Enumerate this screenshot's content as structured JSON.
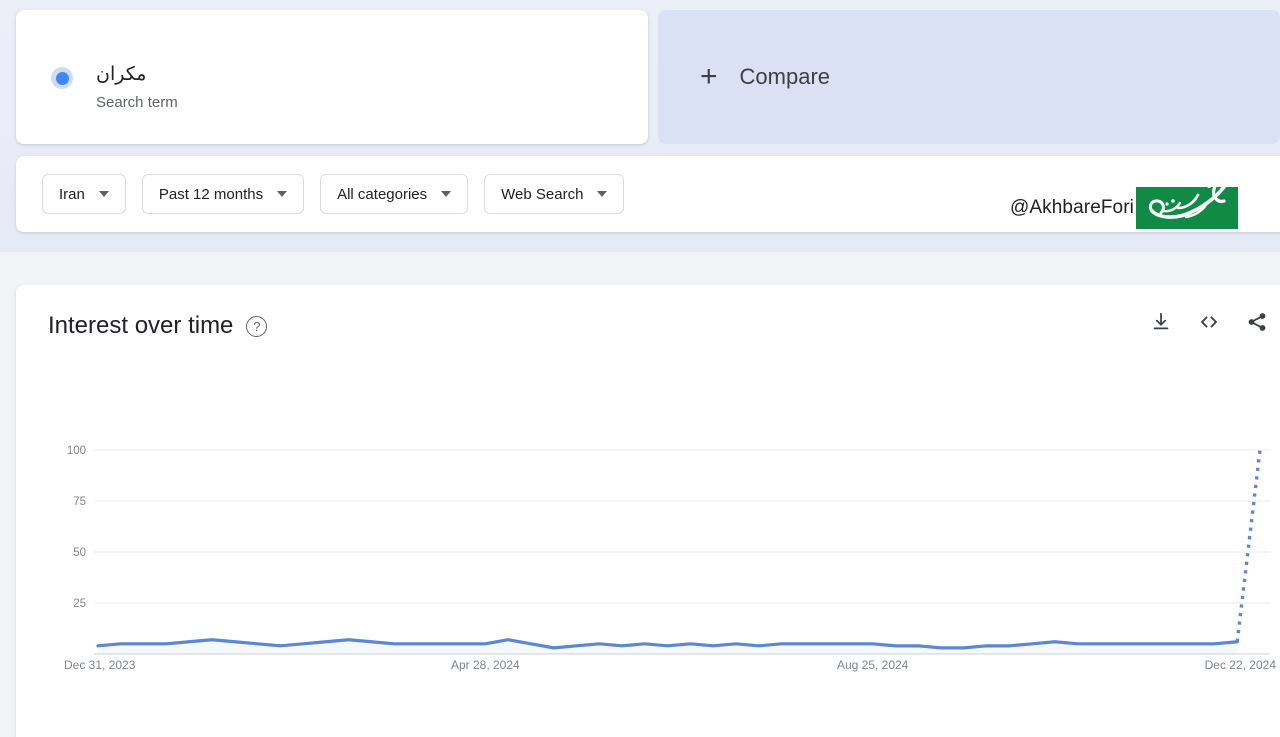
{
  "search_term": {
    "term": "مکران",
    "subtitle": "Search term",
    "dot_color": "#4285f4"
  },
  "compare": {
    "plus_icon": "plus-icon",
    "label": "Compare",
    "background": "#dbe1f5"
  },
  "filters": [
    {
      "name": "location",
      "label": "Iran"
    },
    {
      "name": "time-range",
      "label": "Past 12 months"
    },
    {
      "name": "category",
      "label": "All categories"
    },
    {
      "name": "search-type",
      "label": "Web Search"
    }
  ],
  "watermark": {
    "handle": "@AkhbareFori",
    "logo_text": "خبر فوری",
    "logo_color": "#118a46"
  },
  "chart_panel": {
    "title": "Interest over time",
    "help_icon": "help-circle-icon",
    "actions": [
      {
        "name": "download-icon",
        "label": "Download"
      },
      {
        "name": "embed-code-icon",
        "label": "Embed"
      },
      {
        "name": "share-icon",
        "label": "Share"
      }
    ]
  },
  "chart_data": {
    "type": "line",
    "title": "Interest over time",
    "xlabel": "",
    "ylabel": "",
    "ylim": [
      0,
      100
    ],
    "y_ticks": [
      25,
      50,
      75,
      100
    ],
    "grid": true,
    "legend": false,
    "line_color": "#5b87d4",
    "partial_style": "dotted",
    "x_tick_labels": [
      "Dec 31, 2023",
      "Apr 28, 2024",
      "Aug 25, 2024",
      "Dec 22, 2024"
    ],
    "x_tick_positions": [
      0,
      17,
      34,
      51
    ],
    "x": [
      "Dec 31, 2023",
      "Jan 7, 2024",
      "Jan 14, 2024",
      "Jan 21, 2024",
      "Jan 28, 2024",
      "Feb 4, 2024",
      "Feb 11, 2024",
      "Feb 18, 2024",
      "Feb 25, 2024",
      "Mar 3, 2024",
      "Mar 10, 2024",
      "Mar 17, 2024",
      "Mar 24, 2024",
      "Mar 31, 2024",
      "Apr 7, 2024",
      "Apr 14, 2024",
      "Apr 21, 2024",
      "Apr 28, 2024",
      "May 5, 2024",
      "May 12, 2024",
      "May 19, 2024",
      "May 26, 2024",
      "Jun 2, 2024",
      "Jun 9, 2024",
      "Jun 16, 2024",
      "Jun 23, 2024",
      "Jun 30, 2024",
      "Jul 7, 2024",
      "Jul 14, 2024",
      "Jul 21, 2024",
      "Jul 28, 2024",
      "Aug 4, 2024",
      "Aug 11, 2024",
      "Aug 18, 2024",
      "Aug 25, 2024",
      "Sep 1, 2024",
      "Sep 8, 2024",
      "Sep 15, 2024",
      "Sep 22, 2024",
      "Sep 29, 2024",
      "Oct 6, 2024",
      "Oct 13, 2024",
      "Oct 20, 2024",
      "Oct 27, 2024",
      "Nov 3, 2024",
      "Nov 10, 2024",
      "Nov 17, 2024",
      "Nov 24, 2024",
      "Dec 1, 2024",
      "Dec 8, 2024",
      "Dec 15, 2024",
      "Dec 22, 2024"
    ],
    "values": [
      4,
      5,
      5,
      5,
      6,
      7,
      6,
      5,
      4,
      5,
      6,
      7,
      6,
      5,
      5,
      5,
      5,
      5,
      7,
      5,
      3,
      4,
      5,
      4,
      5,
      4,
      5,
      4,
      5,
      4,
      5,
      5,
      5,
      5,
      5,
      4,
      4,
      3,
      3,
      4,
      4,
      5,
      6,
      5,
      5,
      5,
      5,
      5,
      5,
      5,
      6,
      100
    ],
    "partial_from_index": 50,
    "annotation": "Final data point is partial (dotted) and spikes to 100"
  }
}
